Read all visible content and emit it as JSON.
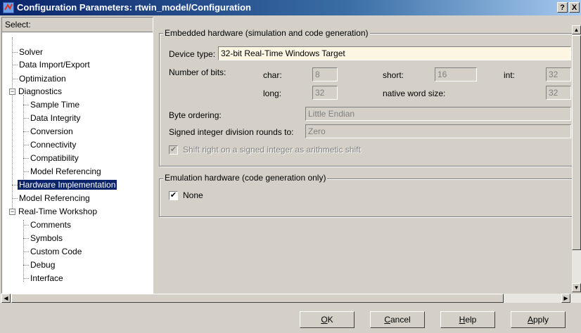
{
  "window": {
    "title": "Configuration Parameters: rtwin_model/Configuration",
    "help_btn": "?",
    "close_btn": "X"
  },
  "tree": {
    "header": "Select:",
    "items": [
      {
        "label": "Solver"
      },
      {
        "label": "Data Import/Export"
      },
      {
        "label": "Optimization"
      },
      {
        "label": "Diagnostics"
      },
      {
        "label": "Sample Time"
      },
      {
        "label": "Data Integrity"
      },
      {
        "label": "Conversion"
      },
      {
        "label": "Connectivity"
      },
      {
        "label": "Compatibility"
      },
      {
        "label": "Model Referencing"
      },
      {
        "label": "Hardware Implementation"
      },
      {
        "label": "Model Referencing"
      },
      {
        "label": "Real-Time Workshop"
      },
      {
        "label": "Comments"
      },
      {
        "label": "Symbols"
      },
      {
        "label": "Custom Code"
      },
      {
        "label": "Debug"
      },
      {
        "label": "Interface"
      }
    ],
    "selected": "Hardware Implementation"
  },
  "embedded": {
    "title": "Embedded hardware (simulation and code generation)",
    "device_type_label": "Device type:",
    "device_type_value": "32-bit Real-Time Windows Target",
    "num_bits_label": "Number of bits:",
    "char_label": "char:",
    "char_value": "8",
    "short_label": "short:",
    "short_value": "16",
    "int_label": "int:",
    "int_value": "32",
    "long_label": "long:",
    "long_value": "32",
    "native_label": "native word size:",
    "native_value": "32",
    "byte_order_label": "Byte ordering:",
    "byte_order_value": "Little Endian",
    "signed_div_label": "Signed integer division rounds to:",
    "signed_div_value": "Zero",
    "shift_label": "Shift right on a signed integer as arithmetic shift",
    "shift_checked": true
  },
  "emulation": {
    "title": "Emulation hardware (code generation only)",
    "none_label": "None",
    "none_checked": true
  },
  "buttons": {
    "ok_u": "O",
    "ok_rest": "K",
    "cancel_u": "C",
    "cancel_rest": "ancel",
    "help_u": "H",
    "help_rest": "elp",
    "apply_u": "A",
    "apply_rest": "pply"
  },
  "glyphs": {
    "check": "✔",
    "minus": "−",
    "up": "▲",
    "down": "▼",
    "left": "◀",
    "right": "▶"
  }
}
